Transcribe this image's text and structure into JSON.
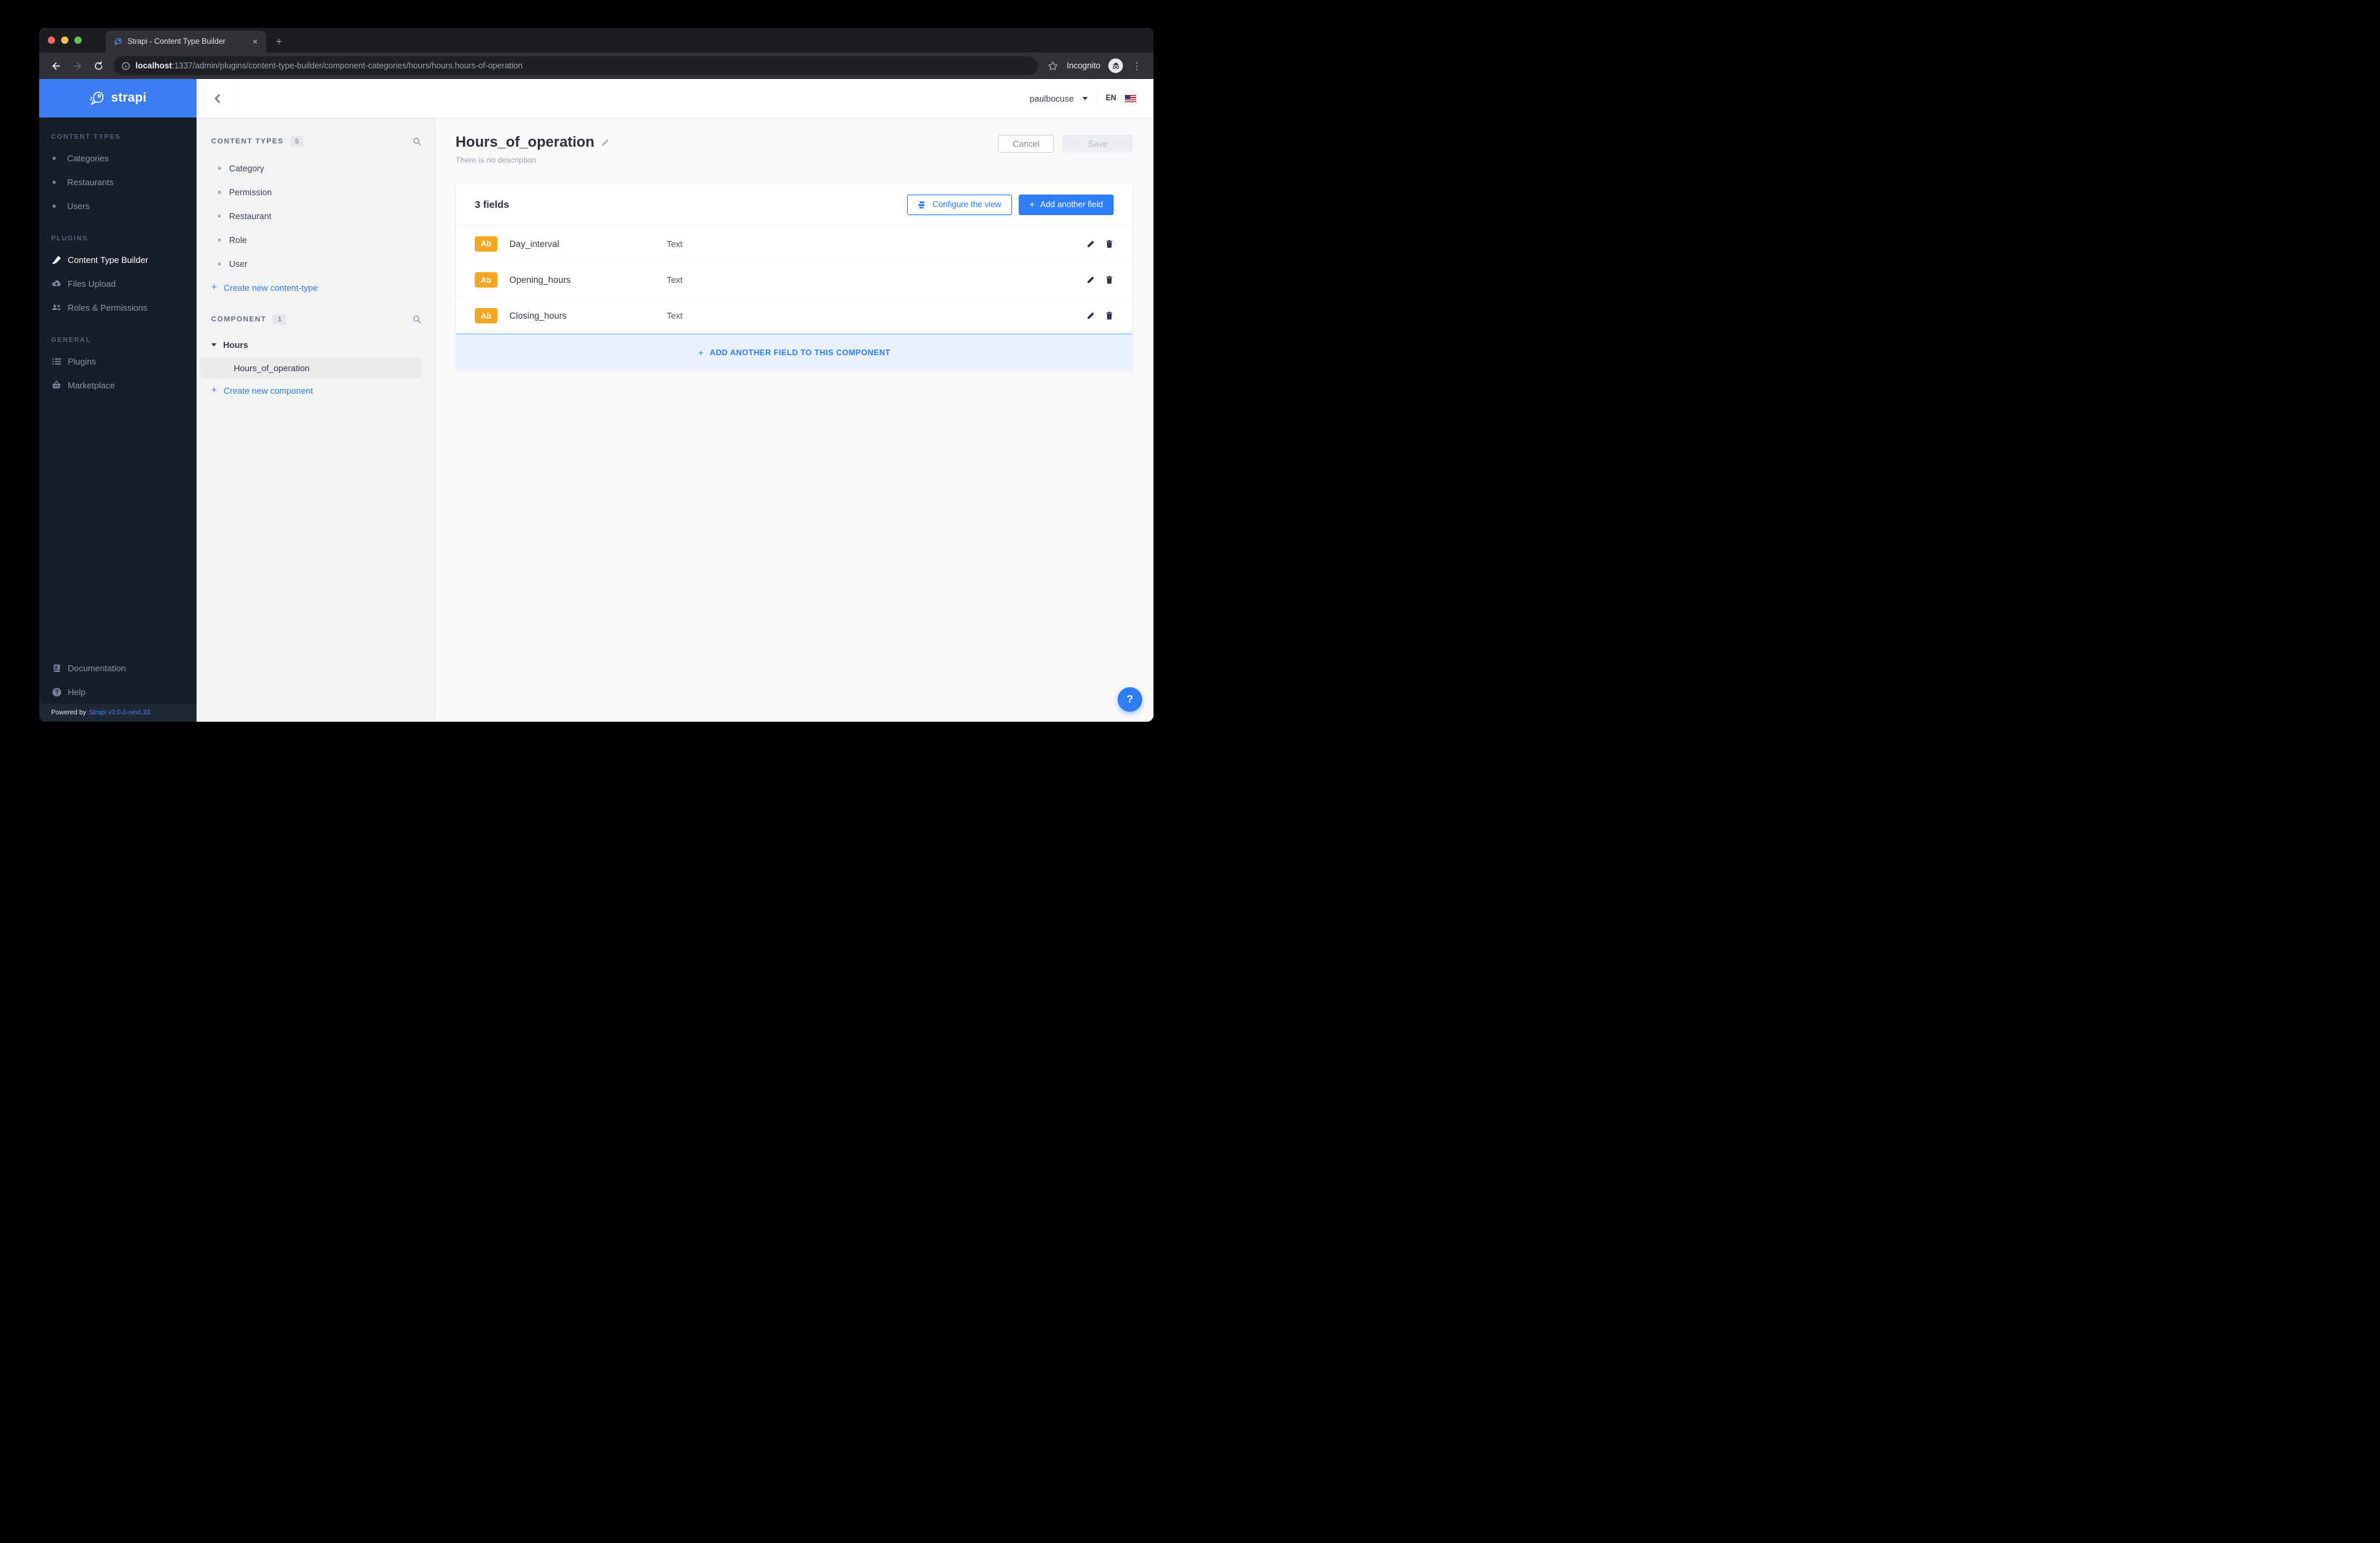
{
  "browser": {
    "tab_title": "Strapi - Content Type Builder",
    "url_host": "localhost",
    "url_rest": ":1337/admin/plugins/content-type-builder/component-categories/hours/hours.hours-of-operation",
    "incognito_label": "Incognito"
  },
  "icons": {
    "plus": "+",
    "close": "×",
    "overflow": "⋮",
    "question": "?"
  },
  "sidebar": {
    "logo_text": "strapi",
    "sections": {
      "content_types": {
        "label": "CONTENT TYPES",
        "items": [
          {
            "label": "Categories"
          },
          {
            "label": "Restaurants"
          },
          {
            "label": "Users"
          }
        ]
      },
      "plugins": {
        "label": "PLUGINS",
        "items": [
          {
            "label": "Content Type Builder"
          },
          {
            "label": "Files Upload"
          },
          {
            "label": "Roles & Permissions"
          }
        ]
      },
      "general": {
        "label": "GENERAL",
        "items": [
          {
            "label": "Plugins"
          },
          {
            "label": "Marketplace"
          }
        ]
      }
    },
    "bottom": {
      "documentation": "Documentation",
      "help": "Help"
    },
    "powered": {
      "prefix": "Powered by",
      "link": "Strapi v3.0.0-next.33"
    }
  },
  "header": {
    "user_name": "paulbocuse",
    "locale": "EN"
  },
  "subnav": {
    "content_types": {
      "label": "CONTENT TYPES",
      "count": "5",
      "items": [
        {
          "label": "Category"
        },
        {
          "label": "Permission"
        },
        {
          "label": "Restaurant"
        },
        {
          "label": "Role"
        },
        {
          "label": "User"
        }
      ],
      "create_label": "Create new content-type"
    },
    "component": {
      "label": "COMPONENT",
      "count": "1",
      "group_label": "Hours",
      "selected_item": "Hours_of_operation",
      "create_label": "Create new component"
    }
  },
  "main": {
    "title": "Hours_of_operation",
    "description": "There is no description",
    "cancel_label": "Cancel",
    "save_label": "Save",
    "fields_count": "3 fields",
    "configure_label": "Configure the view",
    "add_field_label": "Add another field",
    "fields": [
      {
        "badge": "Ab",
        "name": "Day_interval",
        "type": "Text"
      },
      {
        "badge": "Ab",
        "name": "Opening_hours",
        "type": "Text"
      },
      {
        "badge": "Ab",
        "name": "Closing_hours",
        "type": "Text"
      }
    ],
    "footer_label": "ADD ANOTHER FIELD TO THIS COMPONENT"
  },
  "colors": {
    "accent": "#2d7ef7",
    "logo_blue": "#3b7df0",
    "sidebar_bg": "#171e2a",
    "badge_orange": "#f5a623",
    "footer_banner_bg": "#e8f1fc",
    "footer_banner_border": "#abd3f9"
  }
}
